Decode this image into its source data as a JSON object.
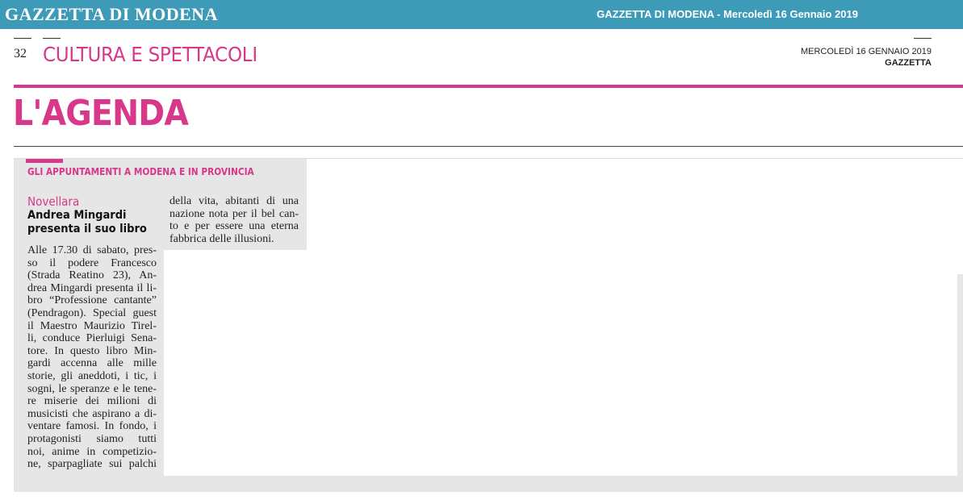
{
  "topbar": {
    "masthead": "GAZZETTA DI MODENA",
    "edition": "GAZZETTA DI MODENA - Mercoledì 16 Gennaio 2019"
  },
  "header": {
    "page_number": "32",
    "section": "CULTURA E SPETTACOLI",
    "date": "MERCOLEDÌ 16 GENNAIO 2019",
    "brand": "GAZZETTA"
  },
  "agenda": {
    "title": "L'AGENDA",
    "kicker": "GLI APPUNTAMENTI A MODENA E IN PROVINCIA"
  },
  "article": {
    "place": "Novellara",
    "headline": "Andrea Mingardi presenta il suo libro",
    "column1": [
      "Alle 17.30 di sabato, pres-",
      "so il podere Francesco",
      "(Strada Reatino 23), An-",
      "drea Mingardi presenta il li-",
      "bro “Professione cantante”",
      "(Pendragon). Special guest",
      "il Maestro Maurizio Tirel-",
      "li, conduce Pierluigi Sena-",
      "tore. In questo libro Min-",
      "gardi accenna alle mille",
      "storie, gli aneddoti, i tic, i",
      "sogni, le speranze e le tene-",
      "re miserie dei milioni di",
      "musicisti che aspirano a di-",
      "ventare famosi. In fondo, i",
      "protagonisti siamo tutti",
      "noi, anime in competizio-",
      "ne, sparpagliate sui palchi"
    ],
    "column2": [
      "della vita, abitanti di una",
      "nazione nota per il bel can-",
      "to e per essere una eterna",
      "fabbrica delle illusioni."
    ]
  },
  "colors": {
    "topbar": "#3e9bb8",
    "accent": "#d8388a",
    "panel": "#e6e6e6"
  }
}
